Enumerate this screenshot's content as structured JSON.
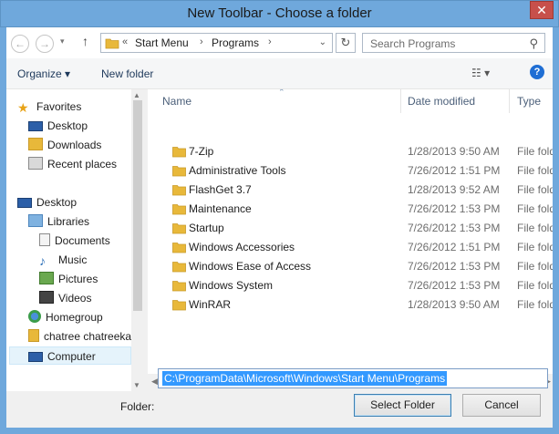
{
  "window": {
    "title": "New Toolbar - Choose a folder",
    "close_label": "✕"
  },
  "navbar": {
    "back_icon": "back-arrow-icon",
    "forward_icon": "forward-arrow-icon",
    "breadcrumb": {
      "overflow": "«",
      "items": [
        "Start Menu",
        "Programs"
      ]
    },
    "search_placeholder": "Search Programs"
  },
  "commands": {
    "organize": "Organize ▾",
    "new_folder": "New folder",
    "help": "?"
  },
  "nav_pane": {
    "items": [
      {
        "label": "Favorites",
        "icon": "star-icon"
      },
      {
        "label": "Desktop",
        "icon": "desktop-icon"
      },
      {
        "label": "Downloads",
        "icon": "downloads-icon"
      },
      {
        "label": "Recent places",
        "icon": "recent-places-icon"
      },
      {
        "label": "Desktop",
        "icon": "desktop-icon"
      },
      {
        "label": "Libraries",
        "icon": "libraries-icon"
      },
      {
        "label": "Documents",
        "icon": "documents-icon"
      },
      {
        "label": "Music",
        "icon": "music-icon"
      },
      {
        "label": "Pictures",
        "icon": "pictures-icon"
      },
      {
        "label": "Videos",
        "icon": "videos-icon"
      },
      {
        "label": "Homegroup",
        "icon": "homegroup-icon"
      },
      {
        "label": "chatree chatreeka",
        "icon": "user-folder-icon"
      },
      {
        "label": "Computer",
        "icon": "computer-icon"
      }
    ]
  },
  "file_list": {
    "columns": [
      "Name",
      "Date modified",
      "Type"
    ],
    "rows": [
      {
        "name": "7-Zip",
        "date": "1/28/2013 9:50 AM",
        "type": "File folder"
      },
      {
        "name": "Administrative Tools",
        "date": "7/26/2012 1:51 PM",
        "type": "File folder"
      },
      {
        "name": "FlashGet 3.7",
        "date": "1/28/2013 9:52 AM",
        "type": "File folder"
      },
      {
        "name": "Maintenance",
        "date": "7/26/2012 1:53 PM",
        "type": "File folder"
      },
      {
        "name": "Startup",
        "date": "7/26/2012 1:53 PM",
        "type": "File folder"
      },
      {
        "name": "Windows Accessories",
        "date": "7/26/2012 1:51 PM",
        "type": "File folder"
      },
      {
        "name": "Windows Ease of Access",
        "date": "7/26/2012 1:53 PM",
        "type": "File folder"
      },
      {
        "name": "Windows System",
        "date": "7/26/2012 1:53 PM",
        "type": "File folder"
      },
      {
        "name": "WinRAR",
        "date": "1/28/2013 9:50 AM",
        "type": "File folder"
      }
    ]
  },
  "footer": {
    "folder_label": "Folder:",
    "folder_value": "C:\\ProgramData\\Microsoft\\Windows\\Start Menu\\Programs",
    "select_button": "Select Folder",
    "cancel_button": "Cancel"
  },
  "colors": {
    "title_bar": "#6fa8dc",
    "selection": "#3399ff",
    "close_button": "#c7504b",
    "folder_yellow": "#e8b83a"
  }
}
